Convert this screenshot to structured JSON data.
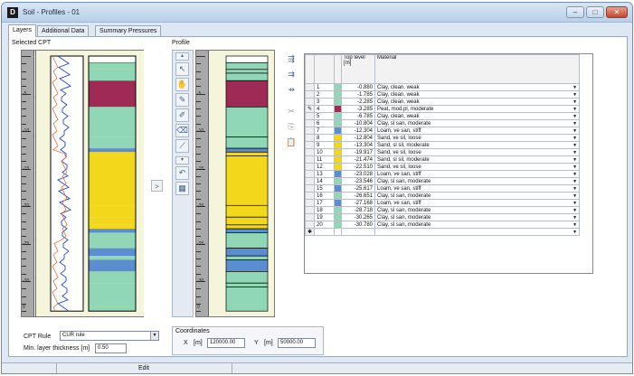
{
  "window": {
    "icon": "D",
    "title": "Soil - Profiles - 01"
  },
  "titlebar_buttons": {
    "minimize": "–",
    "maximize": "□",
    "close": "✕"
  },
  "tabs": [
    {
      "label": "Layers"
    },
    {
      "label": "Additional Data"
    },
    {
      "label": "Summary Pressures"
    }
  ],
  "labels": {
    "selected_cpt": "Selected CPT",
    "profile": "Profile",
    "arrow": ">"
  },
  "ruler": {
    "ticks": [
      "-5",
      "-10",
      "-15",
      "-20",
      "-25",
      "-30"
    ],
    "zero": "0"
  },
  "profile_tools": {
    "up": "▴",
    "down": "▾",
    "icons": [
      "arrow-pointer-icon",
      "hand-icon",
      "pencil-icon",
      "pencil-alt-icon",
      "eraser-icon",
      "dropper-icon",
      "undo-icon",
      "grid-icon"
    ]
  },
  "table_tools": [
    "insert-row-icon",
    "add-row-icon",
    "delete-row-icon",
    "cut-icon",
    "copy-icon",
    "paste-icon"
  ],
  "table": {
    "headers": {
      "top_level": "Top level [m]",
      "material": "Material"
    },
    "rows": [
      {
        "num": "1",
        "level": "-0.880",
        "material": "Clay, clean, weak",
        "color": "#8fd7b5"
      },
      {
        "num": "2",
        "level": "-1.785",
        "material": "Clay, clean, weak",
        "color": "#8fd7b5"
      },
      {
        "num": "3",
        "level": "-2.285",
        "material": "Clay, clean, weak",
        "color": "#8fd7b5"
      },
      {
        "num": "4",
        "level": "-3.285",
        "material": "Peat, mod.pl, moderate",
        "color": "#9e2a55"
      },
      {
        "num": "5",
        "level": "-6.785",
        "material": "Clay, clean, weak",
        "color": "#8fd7b5"
      },
      {
        "num": "6",
        "level": "-10.804",
        "material": "Clay, sl san, moderate",
        "color": "#8fd7b5"
      },
      {
        "num": "7",
        "level": "-12.304",
        "material": "Loam, ve san, stiff",
        "color": "#5b8ed1"
      },
      {
        "num": "8",
        "level": "-12.804",
        "material": "Sand, ve sil, loose",
        "color": "#f2d71b"
      },
      {
        "num": "9",
        "level": "-13.304",
        "material": "Sand, sl sil, moderate",
        "color": "#f2d71b"
      },
      {
        "num": "10",
        "level": "-19.917",
        "material": "Sand, ve sil, loose",
        "color": "#f2d71b"
      },
      {
        "num": "11",
        "level": "-21.474",
        "material": "Sand, sl sil, moderate",
        "color": "#f2d71b"
      },
      {
        "num": "12",
        "level": "-22.510",
        "material": "Sand, ve sil, loose",
        "color": "#f2d71b"
      },
      {
        "num": "13",
        "level": "-23.028",
        "material": "Loam, ve san, stiff",
        "color": "#5b8ed1"
      },
      {
        "num": "14",
        "level": "-23.546",
        "material": "Clay, sl san, moderate",
        "color": "#8fd7b5"
      },
      {
        "num": "15",
        "level": "-25.617",
        "material": "Loam, ve san, stiff",
        "color": "#5b8ed1"
      },
      {
        "num": "16",
        "level": "-26.651",
        "material": "Clay, sl san, moderate",
        "color": "#8fd7b5"
      },
      {
        "num": "17",
        "level": "-27.168",
        "material": "Loam, ve san, stiff",
        "color": "#5b8ed1"
      },
      {
        "num": "18",
        "level": "-28.718",
        "material": "Clay, sl san, moderate",
        "color": "#8fd7b5"
      },
      {
        "num": "19",
        "level": "-30.265",
        "material": "Clay, sl san, moderate",
        "color": "#8fd7b5"
      },
      {
        "num": "20",
        "level": "-30.780",
        "material": "Clay, sl san, moderate",
        "color": "#8fd7b5"
      }
    ],
    "new_row_marker": "✱",
    "edit_marker": "✎"
  },
  "cpt_rule": {
    "label": "CPT Rule",
    "value": "CUR rule"
  },
  "min_layer": {
    "label": "Min. layer thickness [m]",
    "value": "0.50"
  },
  "coordinates": {
    "title": "Coordinates",
    "x_label": "X",
    "x_unit": "[m]",
    "x_value": "120000.00",
    "y_label": "Y",
    "y_unit": "[m]",
    "y_value": "50000.00"
  },
  "status": {
    "text": "Edit"
  }
}
